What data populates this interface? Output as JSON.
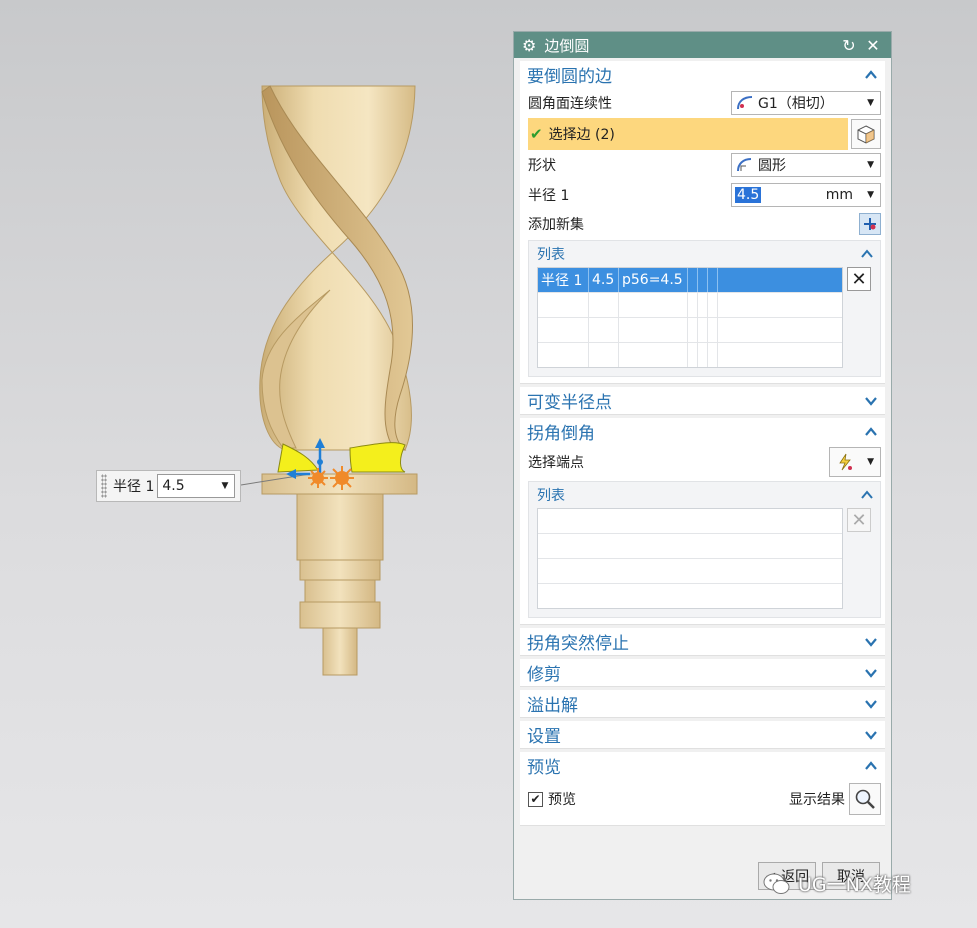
{
  "viewport": {
    "floating_input": {
      "label": "半径 1",
      "value": "4.5"
    }
  },
  "dialog": {
    "title": "边倒圆",
    "sections": {
      "edges": {
        "title": "要倒圆的边",
        "continuity_label": "圆角面连续性",
        "continuity_value": "G1（相切）",
        "select_edge_label": "选择边 (2)",
        "shape_label": "形状",
        "shape_value": "圆形",
        "radius_label": "半径 1",
        "radius_value": "4.5",
        "radius_unit": "mm",
        "add_set_label": "添加新集",
        "list": {
          "title": "列表",
          "rows": [
            [
              "半径 1",
              "4.5",
              "p56=4.5",
              "",
              "",
              ""
            ],
            [
              "",
              "",
              "",
              "",
              "",
              ""
            ],
            [
              "",
              "",
              "",
              "",
              "",
              ""
            ],
            [
              "",
              "",
              "",
              "",
              "",
              ""
            ]
          ]
        }
      },
      "variable_radius": {
        "title": "可变半径点"
      },
      "corner_setback": {
        "title": "拐角倒角",
        "endpoint_label": "选择端点",
        "list": {
          "title": "列表"
        }
      },
      "corner_stop": {
        "title": "拐角突然停止"
      },
      "trim": {
        "title": "修剪"
      },
      "overflow": {
        "title": "溢出解"
      },
      "settings": {
        "title": "设置"
      },
      "preview": {
        "title": "预览",
        "checkbox_label": "预览",
        "show_result_label": "显示结果"
      }
    },
    "footer": {
      "back_label": "< 返回",
      "cancel_label": "取消"
    }
  },
  "watermark": {
    "text": "UG一NX教程"
  },
  "colors": {
    "titlebar": "#5f8f86",
    "section_title": "#2a73b0",
    "selection_highlight": "#fdd77e",
    "list_selected": "#3c8fe0",
    "model": "#e8d3a5"
  }
}
